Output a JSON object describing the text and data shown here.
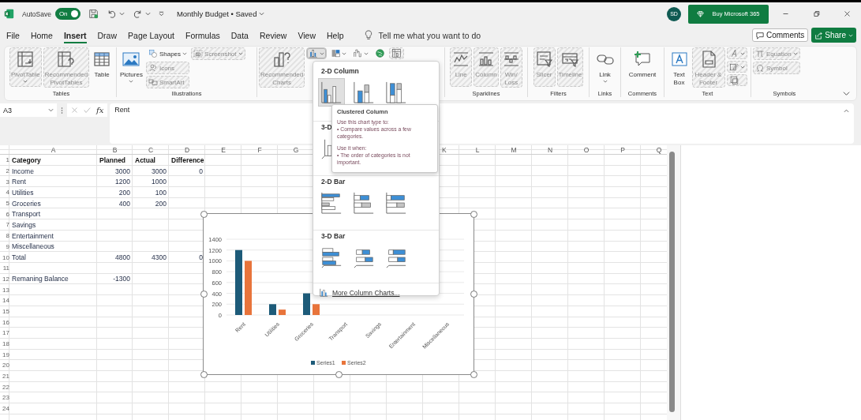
{
  "title_bar": {
    "autosave_label": "AutoSave",
    "autosave": {
      "label": "On",
      "on": true
    },
    "document_title": "Monthly Budget • Saved",
    "avatar": "SD",
    "buy_button": "Buy Microsoft 365"
  },
  "menu": {
    "tabs": [
      {
        "label": "File",
        "selected": false
      },
      {
        "label": "Home",
        "selected": false
      },
      {
        "label": "Insert",
        "selected": true
      },
      {
        "label": "Draw",
        "selected": false
      },
      {
        "label": "Page Layout",
        "selected": false
      },
      {
        "label": "Formulas",
        "selected": false
      },
      {
        "label": "Data",
        "selected": false
      },
      {
        "label": "Review",
        "selected": false
      },
      {
        "label": "View",
        "selected": false
      },
      {
        "label": "Help",
        "selected": false
      }
    ],
    "tell_me": "Tell me what you want to do",
    "comments_button": "Comments",
    "share_button": "Share"
  },
  "ribbon": {
    "groups": [
      {
        "label": "Tables",
        "columns": [
          {
            "items": [
              {
                "kind": "large",
                "label": "PivotTable",
                "disabled": true,
                "caret": true,
                "open": false
              }
            ]
          },
          {
            "items": [
              {
                "kind": "large",
                "label": "Recommended PivotTables",
                "disabled": true,
                "caret": false,
                "open": false
              }
            ]
          },
          {
            "items": [
              {
                "kind": "large",
                "label": "Table",
                "disabled": false,
                "caret": false,
                "open": false
              }
            ]
          }
        ]
      },
      {
        "label": "Illustrations",
        "columns": [
          {
            "items": [
              {
                "kind": "large",
                "label": "Pictures",
                "disabled": false,
                "caret": true,
                "open": false
              }
            ]
          },
          {
            "items": [
              {
                "kind": "small",
                "label": "Shapes",
                "disabled": false,
                "caret": true,
                "open": false
              },
              {
                "kind": "small",
                "label": "Icons",
                "disabled": true,
                "caret": false,
                "open": false
              },
              {
                "kind": "small",
                "label": "SmartArt",
                "disabled": true,
                "caret": false,
                "open": false
              }
            ]
          },
          {
            "items": [
              {
                "kind": "small",
                "label": "Screenshot",
                "disabled": true,
                "caret": true,
                "open": false
              }
            ]
          }
        ]
      },
      {
        "columns": [
          {
            "items": [
              {
                "kind": "large",
                "label": "Recommended Charts",
                "disabled": true,
                "caret": false,
                "open": false
              }
            ]
          },
          {
            "items": [
              {
                "kind": "icon",
                "disabled": false,
                "caret": true,
                "open": true
              }
            ]
          },
          {
            "items": [
              {
                "kind": "icon",
                "disabled": false,
                "caret": true,
                "open": false
              }
            ]
          },
          {
            "items": [
              {
                "kind": "icon",
                "disabled": false,
                "caret": true,
                "open": false
              }
            ]
          },
          {
            "items": [
              {
                "kind": "icon",
                "disabled": false,
                "caret": false,
                "open": false
              }
            ]
          },
          {
            "items": [
              {
                "kind": "icon",
                "disabled": true,
                "caret": false,
                "open": false
              }
            ]
          }
        ]
      },
      {
        "label": "Sparklines",
        "columns": [
          {
            "items": [
              {
                "kind": "large",
                "label": "Line",
                "disabled": true,
                "caret": false,
                "open": false
              }
            ]
          },
          {
            "items": [
              {
                "kind": "large",
                "label": "Column",
                "disabled": true,
                "caret": false,
                "open": false
              }
            ]
          },
          {
            "items": [
              {
                "kind": "large",
                "label": "Win/ Loss",
                "disabled": true,
                "caret": false,
                "open": false
              }
            ]
          }
        ]
      },
      {
        "label": "Filters",
        "columns": [
          {
            "items": [
              {
                "kind": "large",
                "label": "Slicer",
                "disabled": true,
                "caret": false,
                "open": false
              }
            ]
          },
          {
            "items": [
              {
                "kind": "large",
                "label": "Timeline",
                "disabled": true,
                "caret": false,
                "open": false
              }
            ]
          }
        ]
      },
      {
        "label": "Links",
        "columns": [
          {
            "items": [
              {
                "kind": "large",
                "label": "Link",
                "disabled": false,
                "caret": true,
                "open": false
              }
            ]
          }
        ]
      },
      {
        "label": "Comments",
        "columns": [
          {
            "items": [
              {
                "kind": "large",
                "label": "Comment",
                "disabled": false,
                "caret": false,
                "open": false
              }
            ]
          }
        ]
      },
      {
        "label": "Text",
        "columns": [
          {
            "items": [
              {
                "kind": "large",
                "label": "Text Box",
                "disabled": false,
                "caret": false,
                "open": false
              }
            ]
          },
          {
            "items": [
              {
                "kind": "large",
                "label": "Header & Footer",
                "disabled": true,
                "caret": false,
                "open": false
              }
            ]
          },
          {
            "items": [
              {
                "kind": "icon",
                "disabled": true,
                "caret": true,
                "open": false
              },
              {
                "kind": "icon",
                "disabled": true,
                "caret": true,
                "open": false
              },
              {
                "kind": "icon",
                "disabled": true,
                "caret": false,
                "open": false
              }
            ]
          }
        ]
      },
      {
        "label": "Symbols",
        "columns": [
          {
            "items": [
              {
                "kind": "small",
                "label": "Equation",
                "disabled": true,
                "caret": true,
                "open": false
              },
              {
                "kind": "small",
                "label": "Symbol",
                "disabled": true,
                "caret": false,
                "open": false
              }
            ]
          }
        ]
      }
    ]
  },
  "formula_bar": {
    "name_box": "A3",
    "insert_function": "fx",
    "formula": "Rent"
  },
  "sheet": {
    "columns_left": [
      "A",
      "B",
      "C",
      "D",
      "E",
      "F",
      "G"
    ],
    "columns_right": [
      "K",
      "L",
      "M",
      "N",
      "O",
      "P",
      "Q"
    ],
    "rows": [
      {
        "number": "1",
        "kind": "header",
        "cells": [
          "Category",
          "Planned",
          "Actual",
          "Difference"
        ]
      },
      {
        "number": "2",
        "kind": "data",
        "cells": [
          "Income",
          "3000",
          "3000",
          "0"
        ]
      },
      {
        "number": "3",
        "kind": "data",
        "cells": [
          "Rent",
          "1200",
          "1000"
        ]
      },
      {
        "number": "4",
        "kind": "data",
        "cells": [
          "Utilities",
          "200",
          "100"
        ]
      },
      {
        "number": "5",
        "kind": "data",
        "cells": [
          "Groceries",
          "400",
          "200"
        ]
      },
      {
        "number": "6",
        "kind": "data",
        "cells": [
          "Transport"
        ]
      },
      {
        "number": "7",
        "kind": "data",
        "cells": [
          "Savings"
        ]
      },
      {
        "number": "8",
        "kind": "data",
        "cells": [
          "Entertainment"
        ]
      },
      {
        "number": "9",
        "kind": "data",
        "cells": [
          "Miscellaneous"
        ]
      },
      {
        "number": "10",
        "kind": "data",
        "cells": [
          "Total",
          "4800",
          "4300",
          "0"
        ]
      },
      {
        "number": "11",
        "kind": "data"
      },
      {
        "number": "12",
        "kind": "data",
        "cells": [
          "Remaning Balance",
          "-1300"
        ]
      },
      {
        "number": "13",
        "kind": "data"
      },
      {
        "number": "14",
        "kind": "data"
      },
      {
        "number": "15",
        "kind": "data"
      },
      {
        "number": "16",
        "kind": "data"
      },
      {
        "number": "17",
        "kind": "data"
      },
      {
        "number": "18",
        "kind": "data"
      },
      {
        "number": "19",
        "kind": "data"
      },
      {
        "number": "20",
        "kind": "data"
      },
      {
        "number": "21",
        "kind": "data"
      },
      {
        "number": "22",
        "kind": "data"
      },
      {
        "number": "23",
        "kind": "data"
      },
      {
        "number": "24",
        "kind": "data"
      }
    ]
  },
  "chart": {
    "chart_data": {
      "type": "bar",
      "categories": [
        "Rent",
        "Utilities",
        "Groceries",
        "Transport",
        "Savings",
        "Entertainment",
        "Miscellaneous"
      ],
      "series": [
        {
          "name": "Series1",
          "color": "#1d5b79",
          "values": [
            1200,
            200,
            400,
            null,
            null,
            null,
            null
          ]
        },
        {
          "name": "Series2",
          "color": "#e8743b",
          "values": [
            1000,
            100,
            200,
            null,
            null,
            null,
            null
          ]
        }
      ],
      "ylim": [
        0,
        1400
      ],
      "yticks": [
        0,
        200,
        400,
        600,
        800,
        1000,
        1200,
        1400
      ],
      "grid": true,
      "legend": true
    }
  },
  "chart_menu": {
    "sections": [
      {
        "title": "2-D Column",
        "kind": "column2d",
        "options": [
          {
            "selected": true
          },
          {
            "selected": false
          },
          {
            "selected": false
          }
        ]
      },
      {
        "title": "3-D",
        "kind": "column3d",
        "options": [
          {
            "selected": false
          }
        ]
      },
      {
        "title": "2-D Bar",
        "kind": "bar2d",
        "options": [
          {
            "selected": false
          },
          {
            "selected": false
          },
          {
            "selected": false
          }
        ]
      },
      {
        "title": "3-D Bar",
        "kind": "bar3d",
        "options": [
          {
            "selected": false
          },
          {
            "selected": false
          },
          {
            "selected": false
          }
        ]
      }
    ],
    "footer": "More Column Charts..."
  },
  "tooltip": {
    "title": "Clustered Column",
    "lines": [
      "Use this chart type to:",
      "• Compare values across a few categories.",
      "Use it when:",
      "• The order of categories is not important."
    ]
  }
}
